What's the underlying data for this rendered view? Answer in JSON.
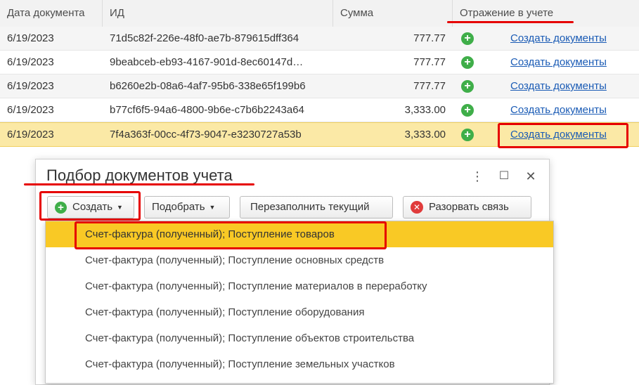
{
  "table": {
    "headers": {
      "date": "Дата документа",
      "id": "ИД",
      "sum": "Сумма",
      "reflection": "Отражение в учете"
    },
    "rows": [
      {
        "date": "6/19/2023",
        "id": "71d5c82f-226e-48f0-ae7b-879615dff364",
        "sum": "777.77",
        "link": "Создать документы"
      },
      {
        "date": "6/19/2023",
        "id": "9beabceb-eb93-4167-901d-8ec60147d…",
        "sum": "777.77",
        "link": "Создать документы"
      },
      {
        "date": "6/19/2023",
        "id": "b6260e2b-08a6-4af7-95b6-338e65f199b6",
        "sum": "777.77",
        "link": "Создать документы"
      },
      {
        "date": "6/19/2023",
        "id": "b77cf6f5-94a6-4800-9b6e-c7b6b2243a64",
        "sum": "3,333.00",
        "link": "Создать документы"
      },
      {
        "date": "6/19/2023",
        "id": "7f4a363f-00cc-4f73-9047-e3230727a53b",
        "sum": "3,333.00",
        "link": "Создать документы"
      }
    ]
  },
  "dialog": {
    "title": "Подбор документов учета",
    "more_icon": "⋮",
    "maximize_icon": "☐",
    "close_icon": "✕",
    "buttons": {
      "create": "Создать",
      "select": "Подобрать",
      "refill": "Перезаполнить текущий",
      "unlink": "Разорвать связь"
    }
  },
  "menu": {
    "items": [
      "Счет-фактура (полученный); Поступление товаров",
      "Счет-фактура (полученный); Поступление основных средств",
      "Счет-фактура (полученный); Поступление материалов в переработку",
      "Счет-фактура (полученный); Поступление оборудования",
      "Счет-фактура (полученный); Поступление объектов строительства",
      "Счет-фактура (полученный); Поступление земельных участков"
    ]
  },
  "colors": {
    "accent_selected_row": "#fbe9a6",
    "menu_highlight": "#f9c925",
    "annotation_red": "#e60000",
    "link": "#1a5bb5",
    "add_green": "#3fae49"
  }
}
